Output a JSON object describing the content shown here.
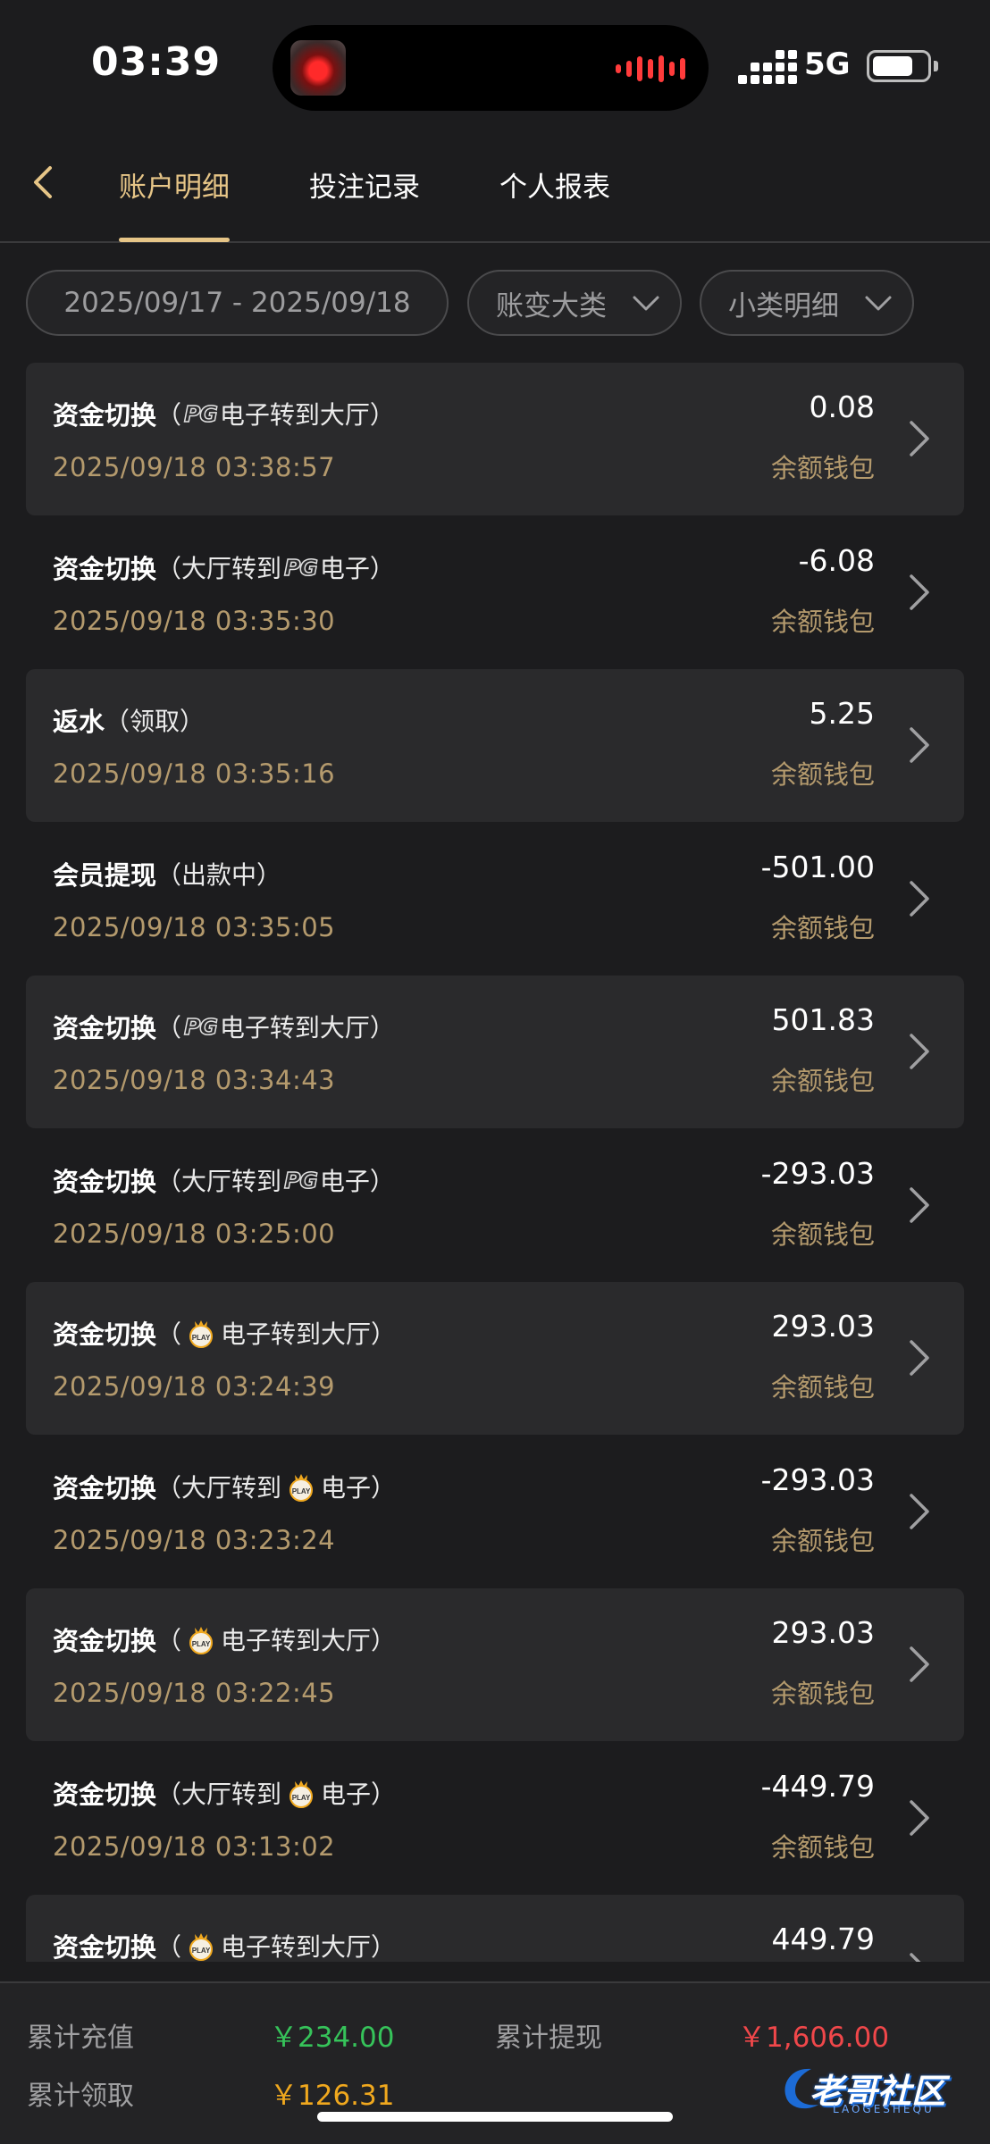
{
  "status_bar": {
    "time": "03:39",
    "network": "5G"
  },
  "nav": {
    "tabs": [
      {
        "label": "账户明细",
        "active": true
      },
      {
        "label": "投注记录",
        "active": false
      },
      {
        "label": "个人报表",
        "active": false
      }
    ]
  },
  "filters": {
    "date_range": "2025/09/17 - 2025/09/18",
    "category": "账变大类",
    "subcategory": "小类明细"
  },
  "records": [
    {
      "title": "资金切换",
      "open": "（",
      "logo": "PG",
      "pre": "",
      "post": "电子转到大厅）",
      "time": "2025/09/18 03:38:57",
      "amount": "0.08",
      "wallet": "余额钱包"
    },
    {
      "title": "资金切换",
      "open": "（",
      "logo": "PG",
      "pre": "大厅转到",
      "post": "电子）",
      "time": "2025/09/18 03:35:30",
      "amount": "-6.08",
      "wallet": "余额钱包"
    },
    {
      "title": "返水",
      "open": "（",
      "logo": "",
      "pre": "领取",
      "post": "）",
      "time": "2025/09/18 03:35:16",
      "amount": "5.25",
      "wallet": "余额钱包"
    },
    {
      "title": "会员提现",
      "open": "（",
      "logo": "",
      "pre": "出款中",
      "post": "）",
      "time": "2025/09/18 03:35:05",
      "amount": "-501.00",
      "wallet": "余额钱包"
    },
    {
      "title": "资金切换",
      "open": "（",
      "logo": "PG",
      "pre": "",
      "post": "电子转到大厅）",
      "time": "2025/09/18 03:34:43",
      "amount": "501.83",
      "wallet": "余额钱包"
    },
    {
      "title": "资金切换",
      "open": "（",
      "logo": "PG",
      "pre": "大厅转到",
      "post": "电子）",
      "time": "2025/09/18 03:25:00",
      "amount": "-293.03",
      "wallet": "余额钱包"
    },
    {
      "title": "资金切换",
      "open": "（",
      "logo": "PLAY",
      "pre": "",
      "post": "电子转到大厅）",
      "time": "2025/09/18 03:24:39",
      "amount": "293.03",
      "wallet": "余额钱包"
    },
    {
      "title": "资金切换",
      "open": "（",
      "logo": "PLAY",
      "pre": "大厅转到",
      "post": "电子）",
      "time": "2025/09/18 03:23:24",
      "amount": "-293.03",
      "wallet": "余额钱包"
    },
    {
      "title": "资金切换",
      "open": "（",
      "logo": "PLAY",
      "pre": "",
      "post": "电子转到大厅）",
      "time": "2025/09/18 03:22:45",
      "amount": "293.03",
      "wallet": "余额钱包"
    },
    {
      "title": "资金切换",
      "open": "（",
      "logo": "PLAY",
      "pre": "大厅转到",
      "post": "电子）",
      "time": "2025/09/18 03:13:02",
      "amount": "-449.79",
      "wallet": "余额钱包"
    },
    {
      "title": "资金切换",
      "open": "（",
      "logo": "PLAY",
      "pre": "",
      "post": "电子转到大厅）",
      "time": "",
      "amount": "449.79",
      "wallet": ""
    }
  ],
  "footer": {
    "deposit_label": "累计充值",
    "deposit_value": "￥234.00",
    "withdraw_label": "累计提现",
    "withdraw_value": "￥1,606.00",
    "claim_label": "累计领取",
    "claim_value": "￥126.31"
  },
  "watermark": {
    "text": "老哥社区",
    "sub": "LAOGESHEQU"
  },
  "colors": {
    "accent": "#e6c587",
    "positive": "#36c35a",
    "negative": "#f0474a",
    "claim": "#f0a81e"
  }
}
